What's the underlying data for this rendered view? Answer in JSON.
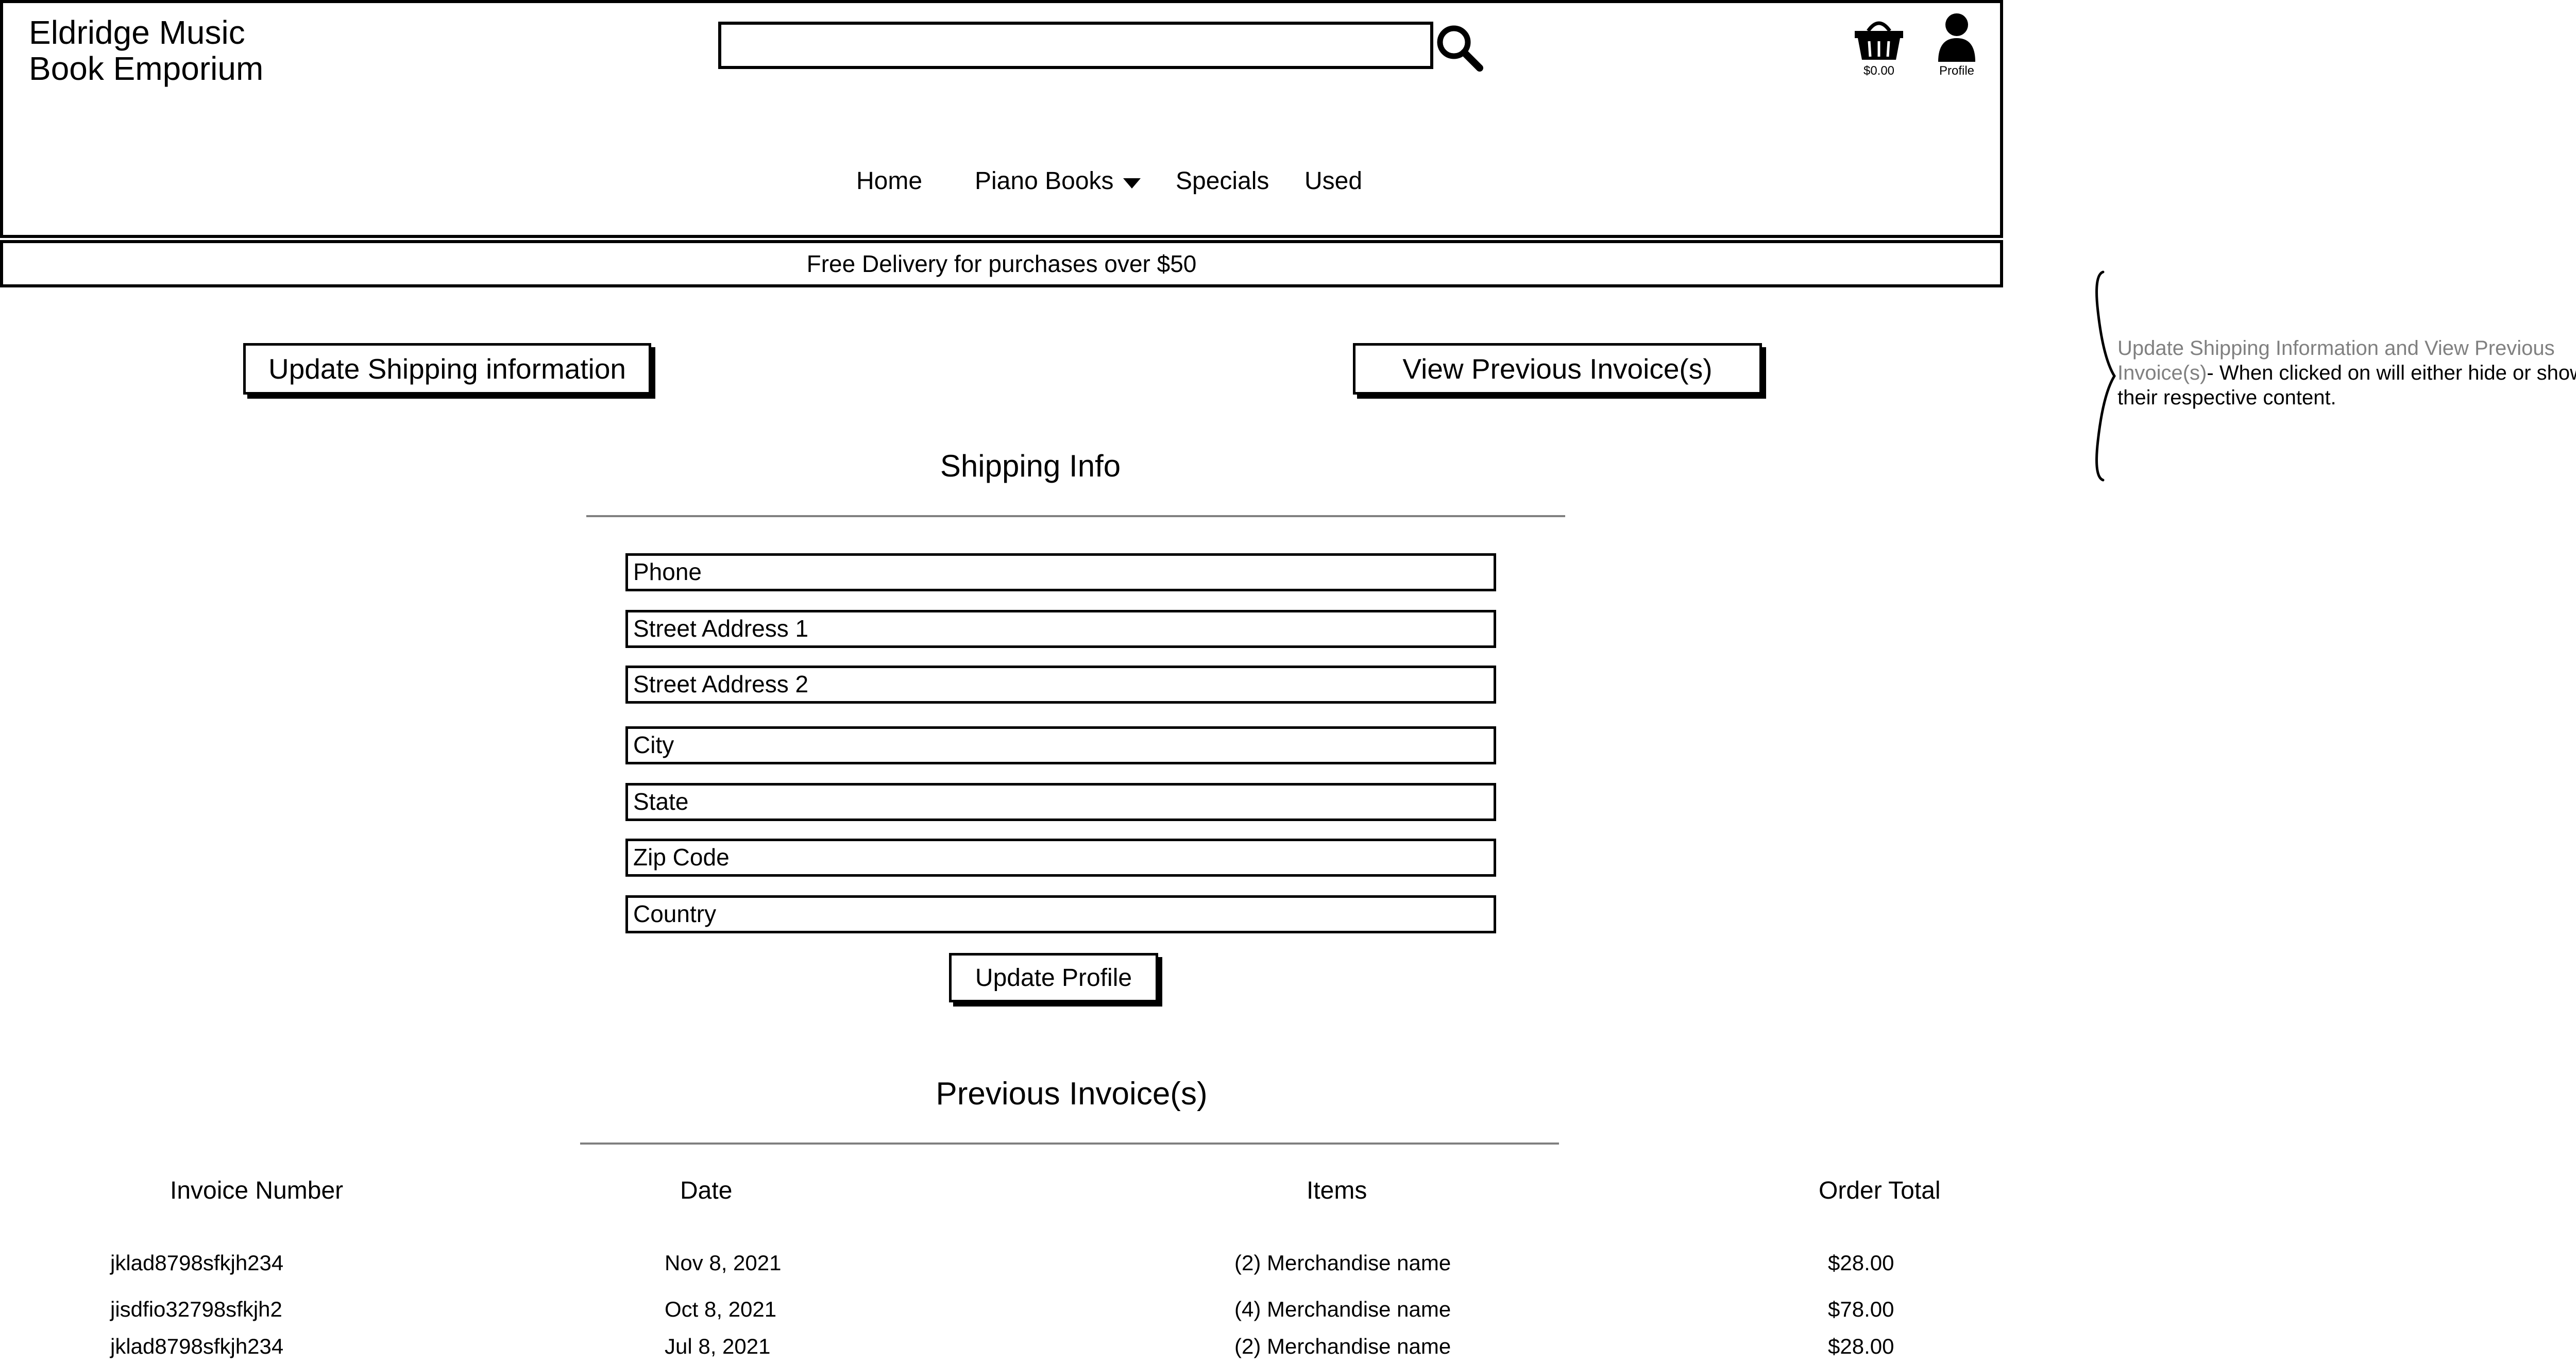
{
  "header": {
    "brand_line1": "Eldridge Music",
    "brand_line2": "Book Emporium",
    "search": {
      "value": "",
      "placeholder": ""
    },
    "cart": {
      "icon": "basket-icon",
      "total": "$0.00"
    },
    "profile": {
      "icon": "user-icon",
      "label": "Profile"
    },
    "nav": {
      "home": "Home",
      "piano_books": "Piano Books",
      "specials": "Specials",
      "used": "Used"
    }
  },
  "banner": {
    "text": "Free Delivery for purchases over $50"
  },
  "buttons": {
    "update_shipping": "Update Shipping information",
    "view_invoices": "View Previous Invoice(s)"
  },
  "shipping": {
    "title": "Shipping Info",
    "fields": [
      "Phone",
      "Street Address 1",
      "Street Address 2",
      "City",
      "State",
      "Zip Code",
      "Country"
    ],
    "update_button": "Update Profile"
  },
  "invoices": {
    "title": "Previous Invoice(s)",
    "columns": [
      "Invoice Number",
      "Date",
      "Items",
      "Order Total"
    ],
    "rows": [
      [
        "jklad8798sfkjh234",
        "Nov 8, 2021",
        "(2) Merchandise name",
        "$28.00"
      ],
      [
        "jisdfio32798sfkjh2",
        "Oct 8, 2021",
        "(4) Merchandise name",
        "$78.00"
      ],
      [
        "jklad8798sfkjh234",
        "Jul 8, 2021",
        "(2) Merchandise name",
        "$28.00"
      ]
    ]
  },
  "annotation": {
    "title": "Update Shipping Information and View Previous Invoice(s)",
    "body": "- When clicked on will either hide or show their respective content."
  }
}
